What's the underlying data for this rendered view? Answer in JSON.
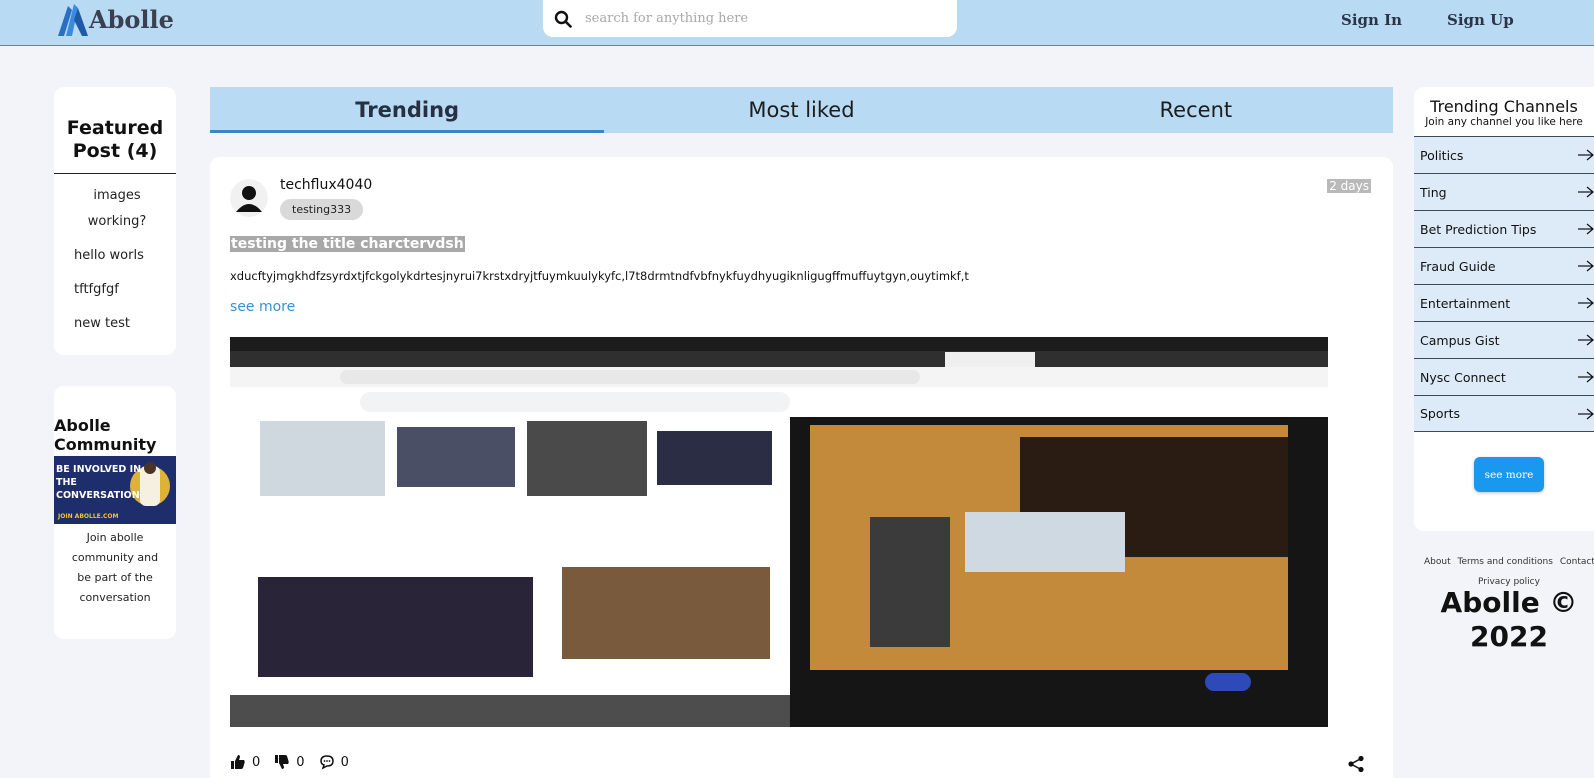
{
  "header": {
    "logo_text": "Abolle",
    "search_placeholder": "search for anything here",
    "sign_in": "Sign In",
    "sign_up": "Sign Up"
  },
  "featured": {
    "title": "Featured Post (4)",
    "items": [
      "images working?",
      "hello worls",
      "tftfgfgf",
      "new test"
    ]
  },
  "community": {
    "title": "Abolle Community",
    "banner_text": "BE INVOLVED IN THE CONVERSATION",
    "banner_sub": "JOIN ABOLLE.COM",
    "description": "Join abolle community and be part of the conversation"
  },
  "tabs": [
    {
      "label": "Trending",
      "active": true
    },
    {
      "label": "Most liked",
      "active": false
    },
    {
      "label": "Recent",
      "active": false
    }
  ],
  "post": {
    "author": "techflux4040",
    "tag": "testing333",
    "time": "2 days",
    "title": "testing the title charctervdsh",
    "body": "xducftyjmgkhdfzsyrdxtjfckgolykdrtesjnyrui7krstxdryjtfuymkuulykyfc,l7t8drmtndfvbfnykfuydhyugiknligugffmuffuytgyn,ouytimkf,t",
    "see_more": "see more",
    "likes": "0",
    "dislikes": "0",
    "comments": "0"
  },
  "channels": {
    "title": "Trending Channels",
    "subtitle": "Join any channel you like here",
    "items": [
      "Politics",
      "Ting",
      "Bet Prediction Tips",
      "Fraud Guide",
      "Entertainment",
      "Campus Gist",
      "Nysc Connect",
      "Sports"
    ],
    "see_more": "see more"
  },
  "footer": {
    "about": "About",
    "terms": "Terms and conditions",
    "contact": "Contact",
    "privacy": "Privacy policy",
    "copyright": "Abolle © 2022"
  },
  "colors": {
    "header_bg": "#b8daf2",
    "accent": "#3591d2",
    "button": "#1a98ee",
    "page_bg": "#f3f4fa"
  }
}
